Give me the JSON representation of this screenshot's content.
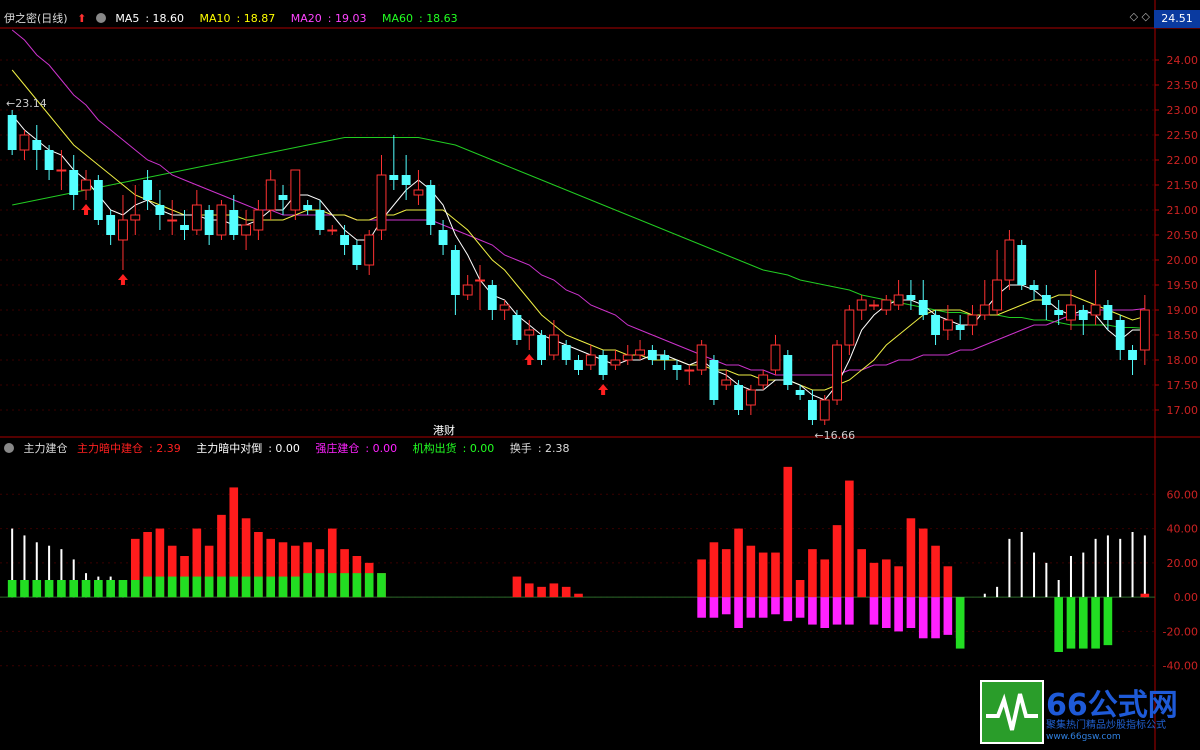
{
  "chart_data": [
    {
      "type": "candlestick",
      "title": "伊之密(日线)",
      "ma_labels": [
        {
          "name": "MA5",
          "value": "18.60",
          "color": "#ffffff"
        },
        {
          "name": "MA10",
          "value": "18.87",
          "color": "#ffff00"
        },
        {
          "name": "MA20",
          "value": "19.03",
          "color": "#ff44ff"
        },
        {
          "name": "MA60",
          "value": "18.63",
          "color": "#00ff00"
        }
      ],
      "ylim": [
        16.6,
        24.6
      ],
      "yticks": [
        "24.00",
        "23.50",
        "23.00",
        "22.50",
        "22.00",
        "21.50",
        "21.00",
        "20.50",
        "20.00",
        "19.50",
        "19.00",
        "18.50",
        "18.00",
        "17.50",
        "17.00"
      ],
      "current_price": "24.51",
      "high_label": "23.14",
      "low_label": "16.66",
      "news_label": "港财",
      "candles": [
        [
          22.9,
          22.2,
          23.0,
          22.1
        ],
        [
          22.2,
          22.5,
          22.6,
          22.0
        ],
        [
          22.4,
          22.2,
          22.7,
          21.8
        ],
        [
          22.2,
          21.8,
          22.3,
          21.6
        ],
        [
          21.8,
          21.8,
          22.2,
          21.4
        ],
        [
          21.8,
          21.3,
          22.1,
          21.0
        ],
        [
          21.4,
          21.6,
          21.8,
          21.2
        ],
        [
          21.6,
          20.8,
          21.7,
          20.7
        ],
        [
          20.9,
          20.5,
          21.0,
          20.3
        ],
        [
          20.4,
          20.8,
          21.3,
          19.8
        ],
        [
          20.8,
          20.9,
          21.5,
          20.5
        ],
        [
          21.6,
          21.2,
          21.8,
          21.0
        ],
        [
          21.1,
          20.9,
          21.4,
          20.6
        ],
        [
          20.8,
          20.8,
          21.2,
          20.5
        ],
        [
          20.7,
          20.6,
          21.0,
          20.4
        ],
        [
          20.6,
          21.1,
          21.4,
          20.5
        ],
        [
          21.0,
          20.5,
          21.1,
          20.3
        ],
        [
          20.5,
          21.1,
          21.2,
          20.4
        ],
        [
          21.0,
          20.5,
          21.3,
          20.4
        ],
        [
          20.5,
          20.7,
          21.0,
          20.2
        ],
        [
          20.6,
          21.0,
          21.2,
          20.4
        ],
        [
          21.0,
          21.6,
          21.8,
          20.8
        ],
        [
          21.3,
          21.2,
          21.5,
          20.9
        ],
        [
          21.0,
          21.8,
          21.8,
          20.8
        ],
        [
          21.1,
          21.0,
          21.2,
          20.9
        ],
        [
          21.0,
          20.6,
          21.2,
          20.5
        ],
        [
          20.6,
          20.6,
          20.7,
          20.5
        ],
        [
          20.5,
          20.3,
          20.7,
          20.1
        ],
        [
          20.3,
          19.9,
          20.4,
          19.8
        ],
        [
          19.9,
          20.5,
          20.6,
          19.7
        ],
        [
          20.6,
          21.7,
          22.1,
          20.4
        ],
        [
          21.7,
          21.6,
          22.5,
          21.4
        ],
        [
          21.7,
          21.5,
          22.1,
          21.2
        ],
        [
          21.3,
          21.4,
          21.8,
          21.1
        ],
        [
          21.5,
          20.7,
          21.6,
          20.5
        ],
        [
          20.6,
          20.3,
          20.8,
          20.1
        ],
        [
          20.2,
          19.3,
          20.3,
          18.9
        ],
        [
          19.3,
          19.5,
          19.7,
          19.2
        ],
        [
          19.6,
          19.6,
          19.9,
          19.0
        ],
        [
          19.5,
          19.0,
          19.6,
          18.8
        ],
        [
          19.0,
          19.1,
          19.2,
          18.8
        ],
        [
          18.9,
          18.4,
          19.0,
          18.3
        ],
        [
          18.5,
          18.6,
          18.8,
          18.2
        ],
        [
          18.5,
          18.0,
          18.6,
          17.9
        ],
        [
          18.1,
          18.5,
          18.8,
          18.0
        ],
        [
          18.3,
          18.0,
          18.4,
          17.9
        ],
        [
          18.0,
          17.8,
          18.1,
          17.7
        ],
        [
          17.9,
          18.1,
          18.3,
          17.8
        ],
        [
          18.1,
          17.7,
          18.2,
          17.6
        ],
        [
          17.9,
          18.0,
          18.2,
          17.8
        ],
        [
          18.0,
          18.1,
          18.3,
          17.9
        ],
        [
          18.1,
          18.2,
          18.4,
          18.0
        ],
        [
          18.2,
          18.0,
          18.3,
          17.9
        ],
        [
          18.1,
          18.0,
          18.2,
          17.8
        ],
        [
          17.9,
          17.8,
          18.0,
          17.6
        ],
        [
          17.8,
          17.8,
          17.9,
          17.5
        ],
        [
          17.8,
          18.3,
          18.4,
          17.7
        ],
        [
          18.0,
          17.2,
          18.1,
          17.1
        ],
        [
          17.5,
          17.6,
          17.8,
          17.4
        ],
        [
          17.5,
          17.0,
          17.6,
          16.9
        ],
        [
          17.1,
          17.4,
          17.5,
          16.9
        ],
        [
          17.5,
          17.7,
          17.8,
          17.4
        ],
        [
          17.8,
          18.3,
          18.5,
          17.7
        ],
        [
          18.1,
          17.5,
          18.2,
          17.4
        ],
        [
          17.4,
          17.3,
          17.5,
          17.2
        ],
        [
          17.2,
          16.8,
          17.4,
          16.7
        ],
        [
          16.8,
          17.2,
          17.3,
          16.7
        ],
        [
          17.2,
          18.3,
          18.4,
          17.1
        ],
        [
          18.3,
          19.0,
          19.1,
          18.1
        ],
        [
          19.0,
          19.2,
          19.3,
          18.8
        ],
        [
          19.1,
          19.1,
          19.2,
          19.0
        ],
        [
          19.0,
          19.2,
          19.3,
          18.9
        ],
        [
          19.1,
          19.3,
          19.6,
          19.0
        ],
        [
          19.3,
          19.2,
          19.6,
          19.0
        ],
        [
          19.2,
          18.9,
          19.6,
          18.8
        ],
        [
          18.9,
          18.5,
          19.0,
          18.3
        ],
        [
          18.6,
          18.8,
          19.1,
          18.4
        ],
        [
          18.7,
          18.6,
          18.9,
          18.4
        ],
        [
          18.7,
          18.9,
          19.1,
          18.5
        ],
        [
          18.9,
          19.1,
          19.6,
          18.8
        ],
        [
          19.0,
          19.6,
          20.2,
          18.9
        ],
        [
          19.6,
          20.4,
          20.6,
          19.4
        ],
        [
          20.3,
          19.5,
          20.4,
          19.4
        ],
        [
          19.5,
          19.4,
          19.6,
          19.2
        ],
        [
          19.3,
          19.1,
          19.5,
          18.8
        ],
        [
          19.0,
          18.9,
          19.2,
          18.7
        ],
        [
          18.8,
          19.1,
          19.4,
          18.6
        ],
        [
          19.0,
          18.8,
          19.1,
          18.5
        ],
        [
          18.9,
          19.1,
          19.8,
          18.7
        ],
        [
          19.1,
          18.8,
          19.2,
          18.6
        ],
        [
          18.8,
          18.2,
          18.9,
          18.0
        ],
        [
          18.2,
          18.0,
          18.3,
          17.7
        ],
        [
          18.2,
          19.0,
          19.3,
          17.9
        ]
      ],
      "ma5": [
        22.9,
        22.6,
        22.4,
        22.2,
        22.1,
        21.8,
        21.6,
        21.3,
        21.0,
        20.9,
        21.1,
        21.2,
        21.0,
        20.9,
        20.9,
        20.9,
        20.8,
        20.8,
        20.7,
        20.7,
        20.8,
        21.0,
        21.0,
        21.3,
        21.3,
        21.2,
        20.9,
        20.6,
        20.4,
        20.4,
        20.8,
        21.1,
        21.4,
        21.6,
        21.4,
        21.1,
        20.5,
        20.1,
        19.6,
        19.3,
        19.2,
        18.9,
        18.7,
        18.5,
        18.4,
        18.3,
        18.2,
        18.1,
        18.0,
        17.9,
        18.0,
        18.0,
        18.1,
        18.1,
        18.0,
        17.9,
        18.0,
        17.8,
        17.7,
        17.5,
        17.4,
        17.4,
        17.6,
        17.6,
        17.5,
        17.3,
        17.2,
        17.5,
        18.0,
        18.6,
        18.9,
        19.1,
        19.2,
        19.2,
        19.1,
        18.9,
        18.8,
        18.7,
        18.7,
        19.0,
        19.3,
        19.5,
        19.5,
        19.4,
        19.2,
        19.0,
        18.9,
        19.0,
        18.9,
        18.6,
        18.4,
        18.6,
        18.6
      ],
      "ma10": [
        23.8,
        23.5,
        23.2,
        22.9,
        22.6,
        22.3,
        22.1,
        21.9,
        21.7,
        21.5,
        21.3,
        21.2,
        21.1,
        21.0,
        20.9,
        20.9,
        20.9,
        20.9,
        20.9,
        20.8,
        20.8,
        20.8,
        20.8,
        20.9,
        21.0,
        21.0,
        20.9,
        20.9,
        20.8,
        20.8,
        20.9,
        20.9,
        21.0,
        21.0,
        21.0,
        21.0,
        20.8,
        20.6,
        20.3,
        20.0,
        19.8,
        19.5,
        19.2,
        18.9,
        18.7,
        18.5,
        18.4,
        18.3,
        18.2,
        18.2,
        18.1,
        18.1,
        18.0,
        18.0,
        18.0,
        17.9,
        17.9,
        17.8,
        17.8,
        17.7,
        17.7,
        17.6,
        17.6,
        17.6,
        17.5,
        17.4,
        17.4,
        17.5,
        17.6,
        17.8,
        18.0,
        18.3,
        18.5,
        18.7,
        18.9,
        19.0,
        19.0,
        19.0,
        18.9,
        18.9,
        18.9,
        19.0,
        19.1,
        19.2,
        19.2,
        19.3,
        19.3,
        19.2,
        19.1,
        19.0,
        18.9,
        18.8,
        18.87
      ],
      "ma20": [
        24.6,
        24.4,
        24.1,
        23.9,
        23.6,
        23.3,
        23.1,
        22.8,
        22.6,
        22.4,
        22.2,
        22.0,
        21.9,
        21.7,
        21.6,
        21.5,
        21.4,
        21.3,
        21.2,
        21.1,
        21.0,
        21.0,
        20.9,
        20.9,
        20.9,
        20.9,
        20.9,
        20.9,
        20.8,
        20.8,
        20.8,
        20.8,
        20.8,
        20.8,
        20.8,
        20.7,
        20.6,
        20.5,
        20.4,
        20.3,
        20.1,
        20.0,
        19.9,
        19.7,
        19.6,
        19.4,
        19.3,
        19.1,
        19.0,
        18.9,
        18.7,
        18.6,
        18.5,
        18.4,
        18.3,
        18.2,
        18.1,
        18.0,
        17.9,
        17.9,
        17.8,
        17.8,
        17.7,
        17.7,
        17.7,
        17.7,
        17.7,
        17.7,
        17.8,
        17.8,
        17.9,
        17.9,
        18.0,
        18.0,
        18.1,
        18.1,
        18.1,
        18.2,
        18.2,
        18.3,
        18.4,
        18.5,
        18.6,
        18.7,
        18.7,
        18.8,
        18.9,
        18.9,
        19.0,
        19.0,
        19.0,
        19.0,
        19.03
      ],
      "ma60": [
        21.1,
        21.15,
        21.2,
        21.25,
        21.3,
        21.35,
        21.4,
        21.45,
        21.5,
        21.55,
        21.6,
        21.65,
        21.7,
        21.75,
        21.8,
        21.85,
        21.9,
        21.95,
        22.0,
        22.05,
        22.1,
        22.15,
        22.2,
        22.25,
        22.3,
        22.35,
        22.4,
        22.45,
        22.45,
        22.45,
        22.45,
        22.45,
        22.45,
        22.45,
        22.4,
        22.35,
        22.3,
        22.2,
        22.1,
        22.0,
        21.9,
        21.8,
        21.7,
        21.6,
        21.5,
        21.4,
        21.3,
        21.2,
        21.1,
        21.0,
        20.9,
        20.8,
        20.7,
        20.6,
        20.5,
        20.4,
        20.3,
        20.2,
        20.1,
        20.0,
        19.9,
        19.8,
        19.75,
        19.7,
        19.6,
        19.55,
        19.5,
        19.45,
        19.4,
        19.3,
        19.25,
        19.2,
        19.15,
        19.1,
        19.05,
        19.0,
        18.95,
        18.95,
        18.9,
        18.9,
        18.9,
        18.85,
        18.85,
        18.8,
        18.8,
        18.75,
        18.7,
        18.7,
        18.7,
        18.7,
        18.65,
        18.65,
        18.63
      ]
    },
    {
      "type": "bar",
      "title": "主力建仓",
      "series_labels": [
        {
          "name": "主力暗中建仓",
          "value": "2.39",
          "color": "#ff2020"
        },
        {
          "name": "主力暗中对倒",
          "value": "0.00",
          "color": "#ffffff"
        },
        {
          "name": "强庄建仓",
          "value": "0.00",
          "color": "#ff22ff"
        },
        {
          "name": "机构出货",
          "value": "0.00",
          "color": "#22ff22"
        },
        {
          "name": "换手",
          "value": "2.38",
          "color": "#dddddd"
        }
      ],
      "ylim": [
        -60,
        80
      ],
      "yticks": [
        "60.00",
        "40.00",
        "20.00",
        "0.00",
        "-20.00",
        "-40.00"
      ],
      "red": [
        0,
        0,
        0,
        0,
        0,
        0,
        0,
        0,
        0,
        0,
        34,
        38,
        40,
        30,
        24,
        40,
        30,
        48,
        64,
        46,
        38,
        34,
        32,
        30,
        32,
        28,
        40,
        28,
        24,
        20,
        14,
        0,
        0,
        0,
        0,
        0,
        0,
        0,
        0,
        0,
        0,
        12,
        8,
        6,
        8,
        6,
        2,
        0,
        0,
        0,
        0,
        0,
        0,
        0,
        0,
        0,
        22,
        32,
        28,
        40,
        30,
        26,
        26,
        76,
        10,
        28,
        22,
        42,
        68,
        28,
        20,
        22,
        18,
        46,
        40,
        30,
        18,
        0,
        0,
        0,
        0,
        0,
        0,
        0,
        0,
        0,
        0,
        0,
        0,
        0,
        0,
        0,
        2
      ],
      "white": [
        40,
        36,
        32,
        30,
        28,
        22,
        14,
        12,
        12,
        10,
        0,
        0,
        0,
        0,
        0,
        0,
        0,
        0,
        0,
        0,
        0,
        0,
        0,
        0,
        0,
        0,
        0,
        0,
        0,
        0,
        0,
        0,
        0,
        0,
        0,
        0,
        0,
        0,
        0,
        0,
        0,
        0,
        0,
        0,
        0,
        0,
        0,
        0,
        0,
        0,
        0,
        0,
        0,
        0,
        0,
        0,
        0,
        0,
        0,
        0,
        0,
        0,
        0,
        0,
        0,
        0,
        0,
        0,
        0,
        0,
        0,
        0,
        0,
        0,
        0,
        0,
        0,
        0,
        0,
        2,
        6,
        34,
        38,
        26,
        20,
        10,
        24,
        26,
        34,
        36,
        34,
        38,
        36,
        22,
        2
      ],
      "magenta": [
        0,
        0,
        0,
        0,
        0,
        0,
        0,
        0,
        0,
        0,
        0,
        0,
        0,
        0,
        0,
        0,
        0,
        0,
        0,
        0,
        0,
        0,
        0,
        0,
        0,
        0,
        0,
        0,
        0,
        0,
        0,
        0,
        0,
        0,
        0,
        0,
        0,
        0,
        0,
        0,
        0,
        0,
        0,
        0,
        0,
        0,
        0,
        0,
        0,
        0,
        0,
        0,
        0,
        0,
        0,
        0,
        -12,
        -12,
        -10,
        -18,
        -12,
        -12,
        -10,
        -14,
        -12,
        -16,
        -18,
        -16,
        -16,
        0,
        -16,
        -18,
        -20,
        -18,
        -24,
        -24,
        -22,
        -24,
        0,
        0,
        0,
        0,
        0,
        0,
        0,
        0,
        0,
        0,
        0,
        0,
        0,
        0,
        0
      ],
      "green": [
        10,
        10,
        10,
        10,
        10,
        10,
        10,
        10,
        10,
        10,
        10,
        12,
        12,
        12,
        12,
        12,
        12,
        12,
        12,
        12,
        12,
        12,
        12,
        12,
        14,
        14,
        14,
        14,
        14,
        14,
        14,
        0,
        0,
        0,
        0,
        0,
        0,
        0,
        0,
        0,
        0,
        0,
        0,
        0,
        0,
        0,
        0,
        0,
        0,
        0,
        0,
        0,
        0,
        0,
        0,
        0,
        0,
        0,
        0,
        0,
        0,
        0,
        0,
        0,
        0,
        0,
        0,
        0,
        0,
        0,
        0,
        0,
        0,
        0,
        0,
        0,
        0,
        -30,
        0,
        0,
        0,
        0,
        0,
        0,
        0,
        -32,
        -30,
        -30,
        -30,
        -28,
        0,
        0,
        0
      ],
      "right_tag": "24.51"
    }
  ],
  "logo": {
    "title": "66公式网",
    "subtitle": "聚集热门精品炒股指标公式",
    "url": "www.66gsw.com"
  },
  "tools": "◇ ◇"
}
